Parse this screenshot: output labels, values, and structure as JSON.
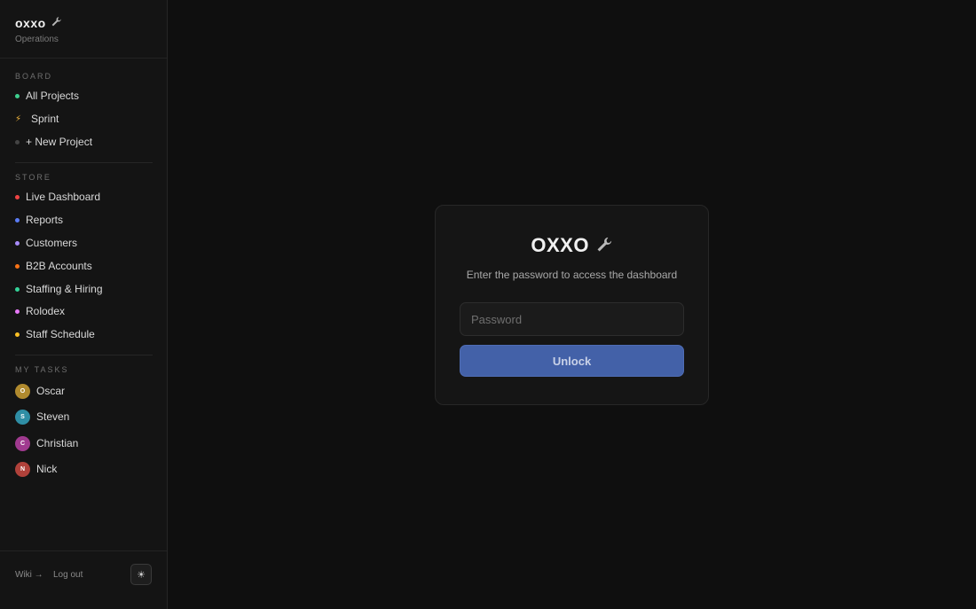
{
  "brand": {
    "name": "oxxo",
    "icon": "wrench-icon",
    "subtitle": "Operations"
  },
  "sections": {
    "board": {
      "label": "BOARD",
      "items": [
        {
          "label": "All Projects",
          "color": "#3ecf8e"
        },
        {
          "label": "Sprint",
          "icon": "lightning-icon",
          "color": "#f5b83d"
        },
        {
          "label": "+ New Project",
          "color": "#444444"
        }
      ]
    },
    "store": {
      "label": "STORE",
      "items": [
        {
          "label": "Live Dashboard",
          "color": "#ef4444"
        },
        {
          "label": "Reports",
          "color": "#5b7cf5"
        },
        {
          "label": "Customers",
          "color": "#a78bfa"
        },
        {
          "label": "B2B Accounts",
          "color": "#f97316"
        },
        {
          "label": "Staffing & Hiring",
          "color": "#34d399"
        },
        {
          "label": "Rolodex",
          "color": "#e879f9"
        },
        {
          "label": "Staff Schedule",
          "color": "#fbbf24"
        }
      ]
    },
    "tasks": {
      "label": "MY TASKS",
      "items": [
        {
          "label": "Oscar",
          "initial": "O",
          "color": "#b08a2e"
        },
        {
          "label": "Steven",
          "initial": "S",
          "color": "#2f8ea5"
        },
        {
          "label": "Christian",
          "initial": "C",
          "color": "#a03a8f"
        },
        {
          "label": "Nick",
          "initial": "N",
          "color": "#b0413a"
        }
      ]
    }
  },
  "footer": {
    "wiki": "Wiki →",
    "logout": "Log out",
    "theme_icon": "sun-icon"
  },
  "login": {
    "logo": "OXXO",
    "logo_icon": "wrench-icon",
    "subtitle": "Enter the password to access the dashboard",
    "password_placeholder": "Password",
    "password_value": "",
    "button": "Unlock"
  },
  "colors": {
    "accent": "#4361a8",
    "background": "#0f0f0f",
    "sidebar": "#141414"
  }
}
